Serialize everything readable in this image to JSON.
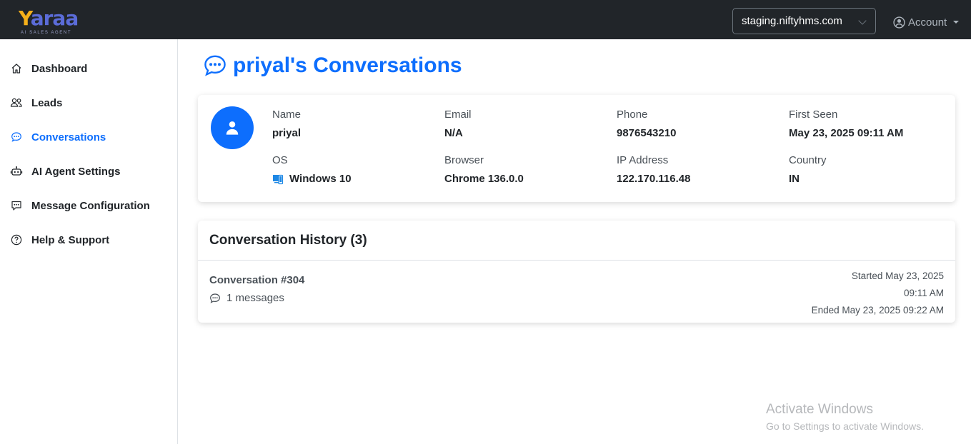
{
  "brand": {
    "logo_text_y": "Y",
    "logo_text_rest": "araa",
    "tagline": "AI SALES AGENT",
    "colors": {
      "gold": "#f5b01a",
      "indigo": "#5b6cd8",
      "accent": "#0d6efd",
      "topbar": "#212529"
    }
  },
  "header": {
    "site_selector": {
      "value": "staging.niftyhms.com",
      "icon": "chevron-down-icon"
    },
    "account": {
      "label": "Account",
      "icon": "user-circle-icon"
    }
  },
  "sidebar": {
    "items": [
      {
        "label": "Dashboard",
        "icon": "house-icon",
        "active": false
      },
      {
        "label": "Leads",
        "icon": "people-icon",
        "active": false
      },
      {
        "label": "Conversations",
        "icon": "chat-dots-icon",
        "active": true
      },
      {
        "label": "AI Agent Settings",
        "icon": "robot-icon",
        "active": false
      },
      {
        "label": "Message Configuration",
        "icon": "message-square-dots-icon",
        "active": false
      },
      {
        "label": "Help & Support",
        "icon": "question-circle-icon",
        "active": false
      }
    ]
  },
  "main": {
    "title": "priyal's Conversations",
    "profile": {
      "name_label": "Name",
      "name": "priyal",
      "email_label": "Email",
      "email": "N/A",
      "phone_label": "Phone",
      "phone": "9876543210",
      "first_seen_label": "First Seen",
      "first_seen": "May 23, 2025 09:11 AM",
      "os_label": "OS",
      "os": "Windows 10",
      "browser_label": "Browser",
      "browser": "Chrome 136.0.0",
      "ip_label": "IP Address",
      "ip": "122.170.116.48",
      "country_label": "Country",
      "country": "IN"
    },
    "history": {
      "title": "Conversation History (3)",
      "conversations": [
        {
          "title": "Conversation #304",
          "messages": "1 messages",
          "started_line1": "Started May 23, 2025",
          "started_line2": "09:11 AM",
          "ended": "Ended May 23, 2025 09:22 AM"
        }
      ]
    }
  },
  "watermark": {
    "line1": "Activate Windows",
    "line2": "Go to Settings to activate Windows."
  }
}
